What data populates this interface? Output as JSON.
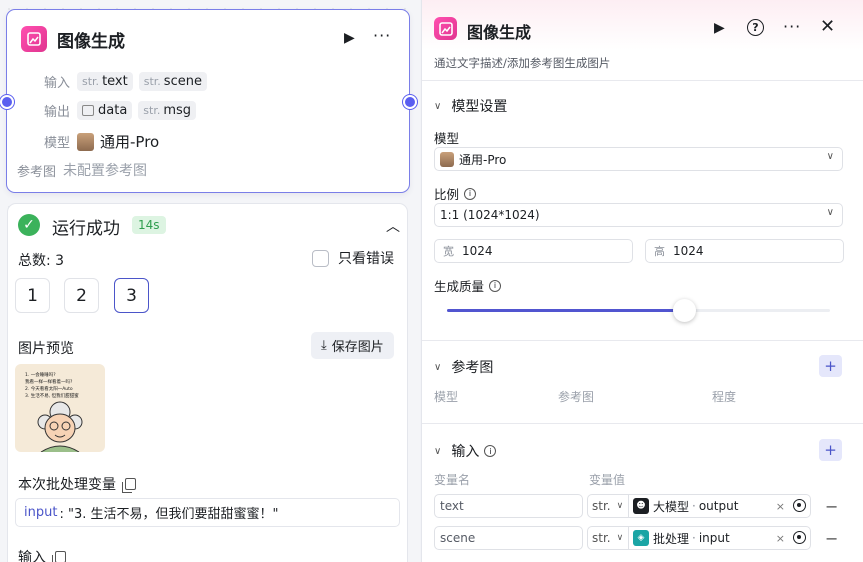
{
  "node": {
    "title": "图像生成",
    "input_label": "输入",
    "inputs": [
      {
        "type": "str.",
        "name": "text"
      },
      {
        "type": "str.",
        "name": "scene"
      }
    ],
    "output_label": "输出",
    "outputs": [
      {
        "type_icon": "image-icon",
        "name": "data"
      },
      {
        "type": "str.",
        "name": "msg"
      }
    ],
    "model_label": "模型",
    "model_value": "通用-Pro",
    "ref_label": "参考图",
    "ref_value": "未配置参考图"
  },
  "result": {
    "status": "运行成功",
    "duration": "14s",
    "total": "总数: 3",
    "only_errors": "只看错误",
    "pages": [
      "1",
      "2",
      "3"
    ],
    "active_page": "3",
    "preview_label": "图片预览",
    "save_button": "保存图片",
    "thumb_lines": [
      "1. 一会睡睡吗?",
      "我看一样一样看着一吗?",
      "2. 今天看看太阳一Auto",
      "3. 生活不易, 但我们甜甜蜜"
    ],
    "batch_vars_label": "本次批处理变量",
    "var_key": "input",
    "var_value": ": \"3. 生活不易，但我们要甜甜蜜蜜！\"",
    "input_label": "输入"
  },
  "panel": {
    "title": "图像生成",
    "description": "通过文字描述/添加参考图生成图片",
    "model_settings": "模型设置",
    "model_label": "模型",
    "model_value": "通用-Pro",
    "ratio_label": "比例",
    "ratio_value": "1:1 (1024*1024)",
    "width_unit": "宽",
    "width_value": "1024",
    "height_unit": "高",
    "height_value": "1024",
    "quality_label": "生成质量",
    "quality_fraction": 0.62,
    "ref_section": "参考图",
    "ref_cols": [
      "模型",
      "参考图",
      "程度"
    ],
    "input_section": "输入",
    "var_name_col": "变量名",
    "var_value_col": "变量值",
    "vars": [
      {
        "name": "text",
        "type": "str.",
        "ref_source": "大模型",
        "ref_field": "output",
        "ref_color": "#1c1f23"
      },
      {
        "name": "scene",
        "type": "str.",
        "ref_source": "批处理",
        "ref_field": "input",
        "ref_color": "#1aa5a5"
      }
    ]
  },
  "colors": {
    "accent": "#4b55c9",
    "brand_pink": "#e0358f",
    "success": "#3bb25b"
  }
}
